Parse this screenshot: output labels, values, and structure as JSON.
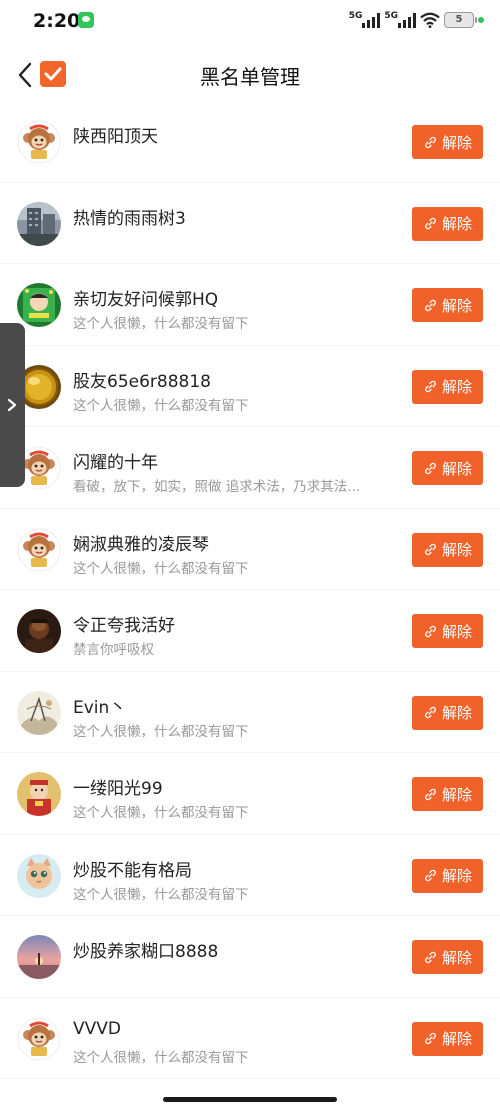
{
  "status": {
    "time": "2:20",
    "network1": "5G",
    "network2": "5G",
    "battery": "5"
  },
  "header": {
    "title": "黑名单管理"
  },
  "unblock_label": "解除",
  "users": [
    {
      "name": "陕西阳顶天",
      "bio": "",
      "avatar": "monkey-mascot"
    },
    {
      "name": "热情的雨雨树3",
      "bio": "",
      "avatar": "building-photo"
    },
    {
      "name": "亲切友好问候郭HQ",
      "bio": "这个人很懒，什么都没有留下",
      "avatar": "green-poster"
    },
    {
      "name": "股友65e6r88818",
      "bio": "这个人很懒，什么都没有留下",
      "avatar": "gold-ball"
    },
    {
      "name": "闪耀的十年",
      "bio": "看破，放下，如实，照做  追求术法，乃求其法...",
      "avatar": "monkey-mascot"
    },
    {
      "name": "娴淑典雅的凌辰琴",
      "bio": "这个人很懒，什么都没有留下",
      "avatar": "monkey-mascot"
    },
    {
      "name": "令正夸我活好",
      "bio": "禁言你呼吸权",
      "avatar": "dark-portrait"
    },
    {
      "name": "Evin丶",
      "bio": "这个人很懒，什么都没有留下",
      "avatar": "ink-painting"
    },
    {
      "name": "一缕阳光99",
      "bio": "这个人很懒，什么都没有留下",
      "avatar": "fortune-god"
    },
    {
      "name": "炒股不能有格局",
      "bio": "这个人很懒，什么都没有留下",
      "avatar": "cartoon-cat"
    },
    {
      "name": "炒股养家糊口8888",
      "bio": "",
      "avatar": "sunset-photo"
    },
    {
      "name": "VVVD",
      "bio": "这个人很懒，什么都没有留下",
      "avatar": "monkey-mascot"
    }
  ]
}
